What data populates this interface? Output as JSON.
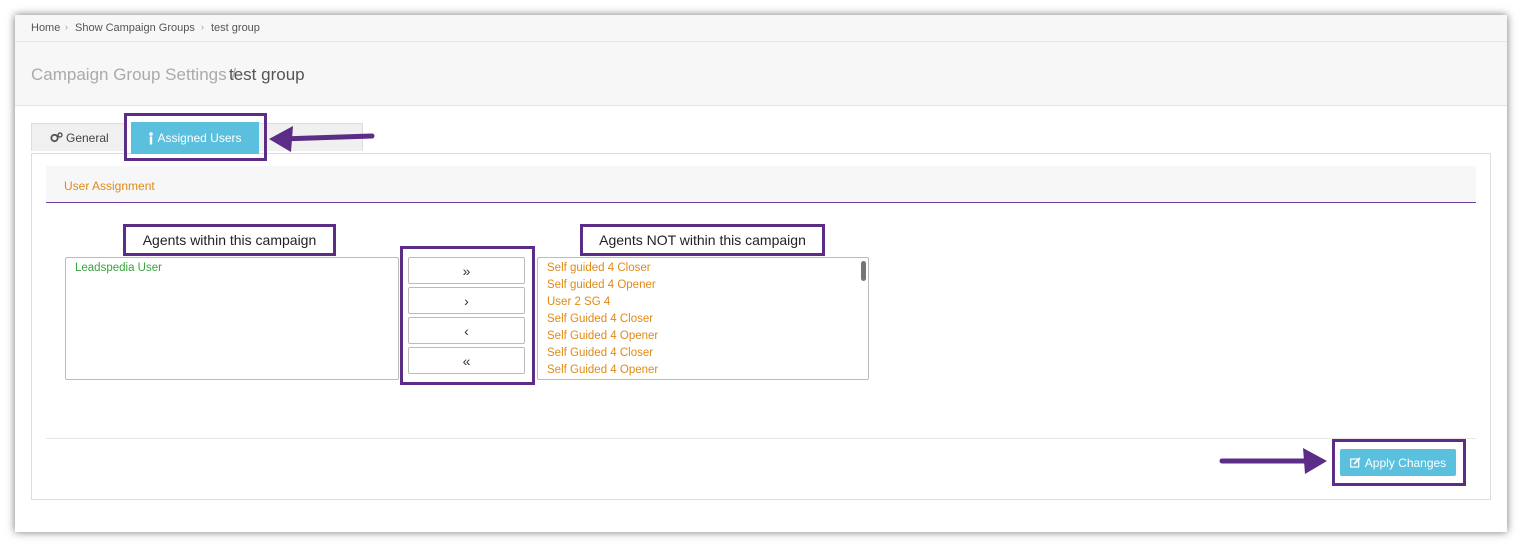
{
  "breadcrumb": {
    "home": "Home",
    "groups": "Show Campaign Groups",
    "current": "test group",
    "separator": "›"
  },
  "page_title": {
    "prefix": "Campaign Group Settings /",
    "name": "test group"
  },
  "tabs": {
    "general": "General",
    "assigned_users": "Assigned Users"
  },
  "section": {
    "title": "User Assignment"
  },
  "labels": {
    "within": "Agents within this campaign",
    "not_within": "Agents NOT within this campaign"
  },
  "agents_within": [
    {
      "name": "Leadspedia User"
    }
  ],
  "agents_not_within": [
    {
      "name": "Self guided 4 Closer"
    },
    {
      "name": "Self guided 4 Opener"
    },
    {
      "name": "User 2 SG 4"
    },
    {
      "name": "Self Guided 4 Closer"
    },
    {
      "name": "Self Guided 4 Opener"
    },
    {
      "name": "Self Guided 4 Closer"
    },
    {
      "name": "Self Guided 4 Opener"
    }
  ],
  "move_buttons": {
    "move_all_left": "»",
    "move_selected_left": "›",
    "move_selected_right": "‹",
    "move_all_right": "«"
  },
  "apply": {
    "label": "Apply Changes"
  },
  "colors": {
    "accent": "#5bc0de",
    "highlight": "#5b2d86",
    "assigned": "#3aa340",
    "unassigned": "#e08a17",
    "section_title": "#e08a17"
  }
}
